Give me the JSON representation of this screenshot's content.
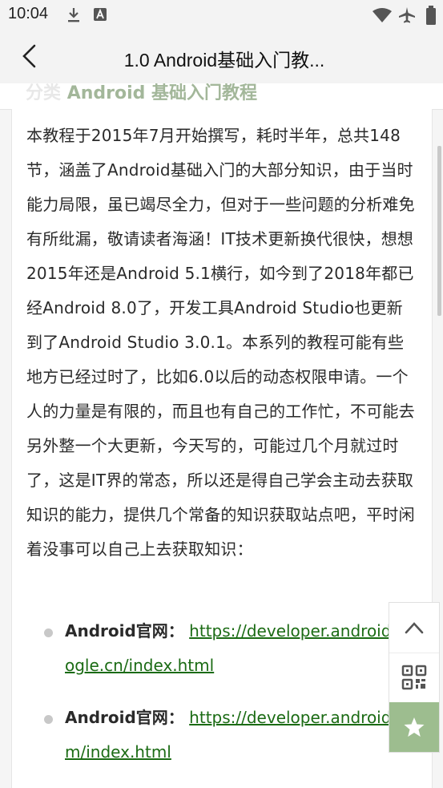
{
  "status_bar": {
    "time": "10:04"
  },
  "app_bar": {
    "title": "1.0 Android基础入门教..."
  },
  "category": {
    "prefix": "分类",
    "link": "Android 基础入门教程"
  },
  "article": {
    "paragraph": "本教程于2015年7月开始撰写，耗时半年，总共148节，涵盖了Android基础入门的大部分知识，由于当时能力局限，虽已竭尽全力，但对于一些问题的分析难免有所纰漏，敬请读者海涵！IT技术更新换代很快，想想2015年还是Android 5.1横行，如今到了2018年都已经Android 8.0了，开发工具Android Studio也更新到了Android Studio 3.0.1。本系列的教程可能有些地方已经过时了，比如6.0以后的动态权限申请。一个人的力量是有限的，而且也有自己的工作忙，不可能去另外整一个大更新，今天写的，可能过几个月就过时了，这是IT界的常态，所以还是得自己学会主动去获取知识的能力，提供几个常备的知识获取站点吧，平时闲着没事可以自己上去获取知识：",
    "links": [
      {
        "label": "Android官网：",
        "url": "https://developer.android.google.cn/index.html"
      },
      {
        "label": "Android官网：",
        "url": "https://developer.android.com/index.html"
      }
    ]
  },
  "fab": {
    "top_icon": "chevron-up-icon",
    "qr_icon": "qr-code-icon",
    "star_icon": "star-icon"
  },
  "colors": {
    "link": "#1b6b14",
    "accent": "#9dbd8f",
    "category_link": "#a3b79a"
  }
}
